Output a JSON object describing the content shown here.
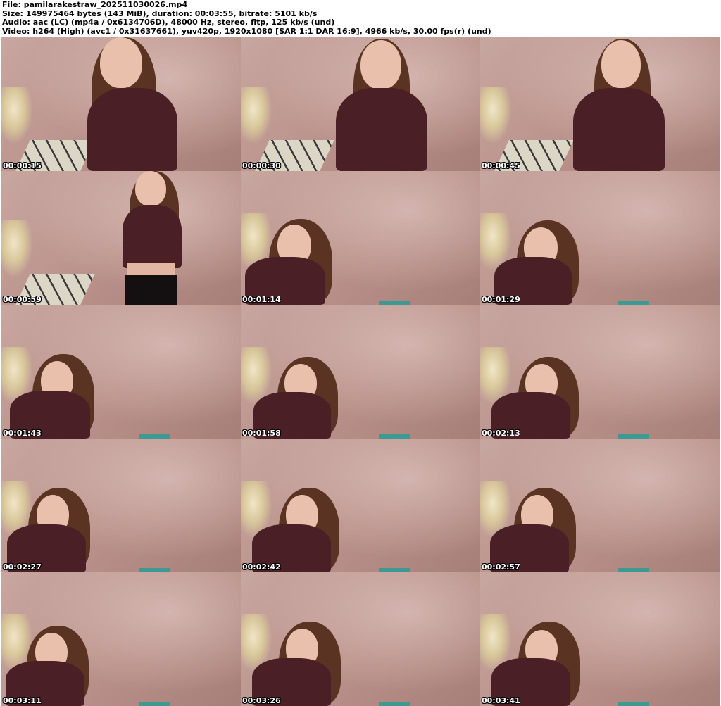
{
  "header": {
    "file": "File: pamilarakestraw_202511030026.mp4",
    "size": "Size: 149975464 bytes (143 MiB), duration: 00:03:55, bitrate: 5101 kb/s",
    "audio": "Audio: aac (LC) (mp4a / 0x6134706D), 48000 Hz, stereo, fltp, 125 kb/s (und)",
    "video": "Video: h264 (High) (avc1 / 0x31637661), yuv420p, 1920x1080 [SAR 1:1 DAR 16:9], 4966 kb/s, 30.00 fps(r) (und)"
  },
  "thumbnails": [
    {
      "timestamp": "00:00:15"
    },
    {
      "timestamp": "00:00:30"
    },
    {
      "timestamp": "00:00:45"
    },
    {
      "timestamp": "00:00:59"
    },
    {
      "timestamp": "00:01:14"
    },
    {
      "timestamp": "00:01:29"
    },
    {
      "timestamp": "00:01:43"
    },
    {
      "timestamp": "00:01:58"
    },
    {
      "timestamp": "00:02:13"
    },
    {
      "timestamp": "00:02:27"
    },
    {
      "timestamp": "00:02:42"
    },
    {
      "timestamp": "00:02:57"
    },
    {
      "timestamp": "00:03:11"
    },
    {
      "timestamp": "00:03:26"
    },
    {
      "timestamp": "00:03:41"
    }
  ]
}
